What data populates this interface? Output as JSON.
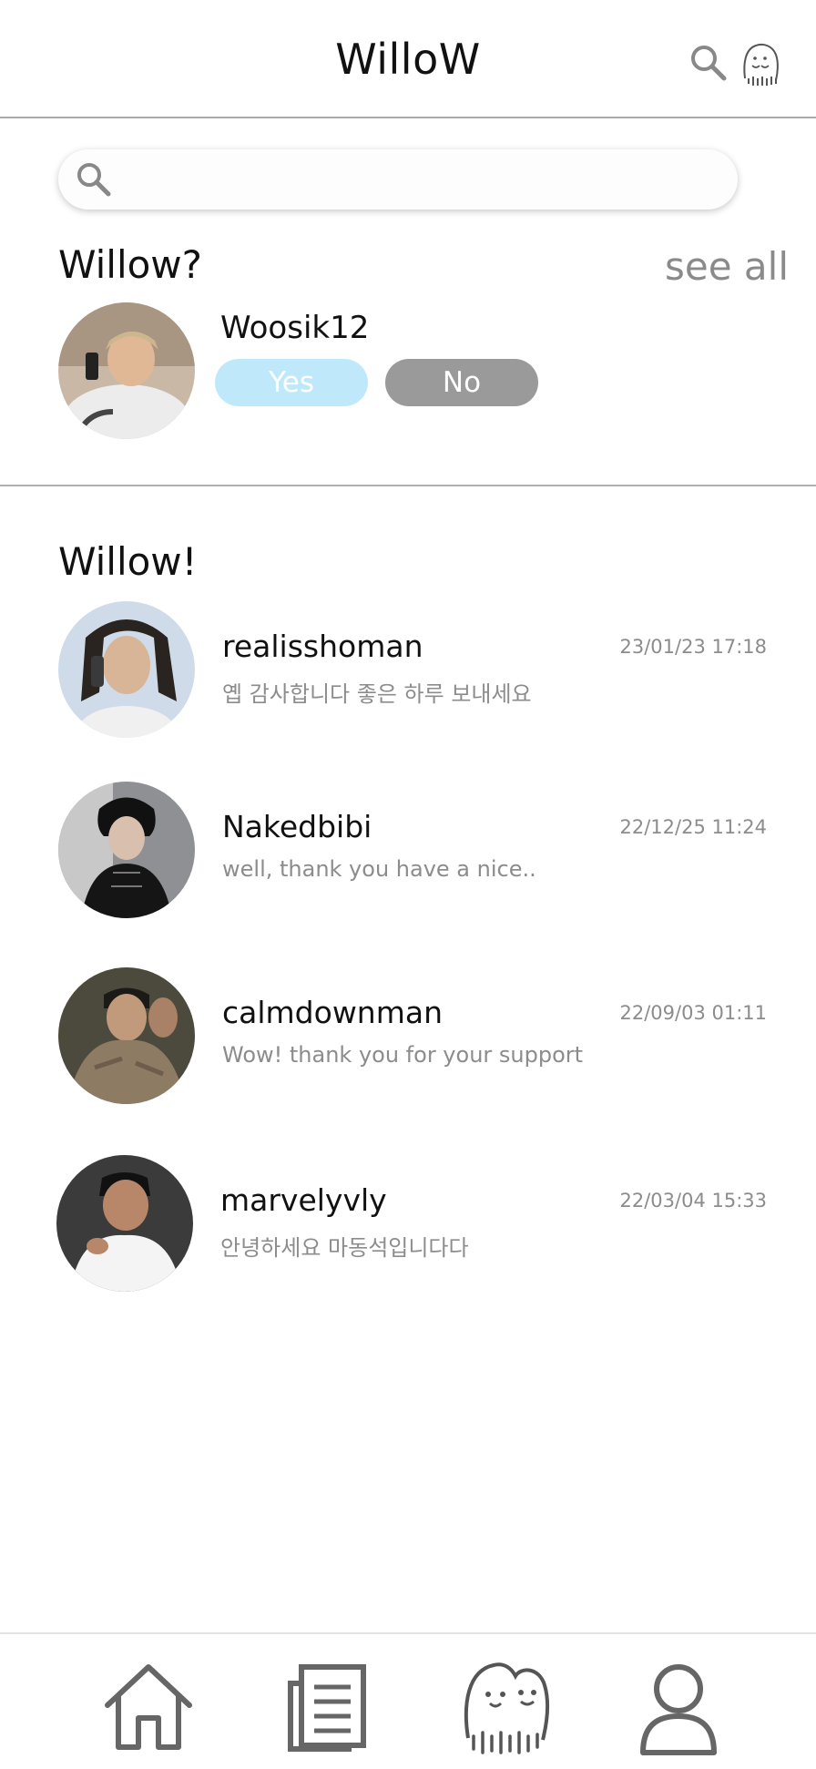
{
  "header": {
    "title": "WilloW",
    "search_icon": "search-icon",
    "profile_icon": "willow-ghost-icon"
  },
  "search": {
    "placeholder": "",
    "value": ""
  },
  "requests": {
    "title": "Willow?",
    "see_all_label": "see all",
    "items": [
      {
        "username": "Woosik12",
        "yes_label": "Yes",
        "no_label": "No",
        "accent_yes": "#bfe9fb",
        "accent_no": "#9a9a9a"
      }
    ]
  },
  "chats": {
    "title": "Willow!",
    "items": [
      {
        "username": "realisshoman",
        "message": "옙 감사합니다 좋은 하루 보내세요",
        "time": "23/01/23 17:18"
      },
      {
        "username": "Nakedbibi",
        "message": "well, thank you have a nice..",
        "time": "22/12/25 11:24"
      },
      {
        "username": "calmdownman",
        "message": "Wow! thank you for your support",
        "time": "22/09/03 01:11"
      },
      {
        "username": "marvelyvly",
        "message": "안녕하세요 마동석입니다다",
        "time": "22/03/04 15:33"
      }
    ]
  },
  "bottom_nav": {
    "items": [
      {
        "name": "home",
        "icon": "home-icon"
      },
      {
        "name": "feed",
        "icon": "document-list-icon"
      },
      {
        "name": "willow",
        "icon": "willow-ghost-icon"
      },
      {
        "name": "profile",
        "icon": "user-icon"
      }
    ]
  }
}
